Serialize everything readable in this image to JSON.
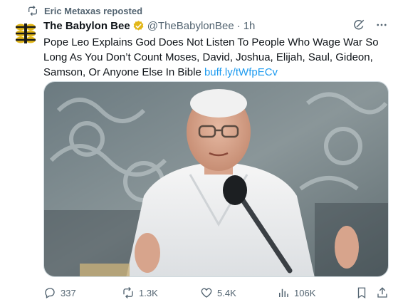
{
  "repost": {
    "text": "Eric Metaxas reposted",
    "icon": "repost-icon"
  },
  "author": {
    "name": "The Babylon Bee",
    "handle": "@TheBabylonBee",
    "separator": "·",
    "time": "1h",
    "avatar_icon": "babylon-bee-logo",
    "verified_icon": "verified-badge-icon"
  },
  "tweet": {
    "text": "Pope Leo Explains God Does Not Listen To People Who Wage War So Long As You Don’t Count Moses, David, Joshua, Elijah, Saul, Gideon, Samson, Or Anyone Else In Bible",
    "link": "buff.ly/tWfpECv"
  },
  "media": {
    "alt_icon": "pope-photo"
  },
  "actions": {
    "replies": "337",
    "reposts": "1.3K",
    "likes": "5.4K",
    "views": "106K"
  },
  "colors": {
    "link": "#1d9bf0",
    "muted": "#536471",
    "verified": "#e2b719",
    "text": "#0f1419"
  }
}
